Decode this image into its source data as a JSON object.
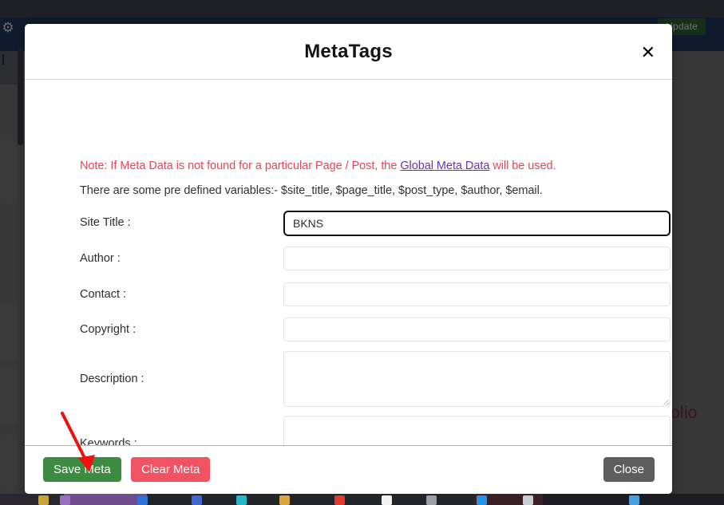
{
  "background": {
    "adminbar": {
      "gear_icon": "gear-icon",
      "update_label": "Update"
    },
    "page_text_fragment": "tfolio"
  },
  "modal": {
    "title": "MetaTags",
    "close_icon": "close-icon",
    "close_icon_glyph": "✕",
    "note": {
      "prefix": "Note: If Meta Data is not found for a particular Page / Post, the ",
      "link": "Global Meta Data",
      "suffix": " will be used."
    },
    "variables_line": "There are some pre defined variables:- $site_title, $page_title, $post_type, $author, $email.",
    "fields": [
      {
        "label": "Site Title :",
        "value": "BKNS",
        "placeholder": "",
        "type": "text",
        "focused": true
      },
      {
        "label": "Author :",
        "value": "",
        "placeholder": "",
        "type": "text",
        "focused": false
      },
      {
        "label": "Contact :",
        "value": "",
        "placeholder": "",
        "type": "text",
        "focused": false
      },
      {
        "label": "Copyright :",
        "value": "",
        "placeholder": "",
        "type": "text",
        "focused": false
      },
      {
        "label": "Description :",
        "value": "",
        "placeholder": "",
        "type": "textarea",
        "focused": false
      },
      {
        "label": "Keywords :",
        "value": "",
        "placeholder": "",
        "type": "textarea",
        "focused": false
      }
    ],
    "footer": {
      "save_label": "Save Meta",
      "clear_label": "Clear Meta",
      "close_label": "Close"
    }
  },
  "annotation": {
    "type": "red-arrow",
    "points_to": "Save Meta",
    "color": "#ee1111"
  },
  "colors": {
    "accent_green": "#3d8b40",
    "accent_red": "#f05361",
    "accent_gray": "#5e5e5e",
    "note_red": "#e8455a",
    "link_purple": "#6b30b8",
    "adminbar_navy": "#1d3557",
    "backdrop": "#545454"
  }
}
